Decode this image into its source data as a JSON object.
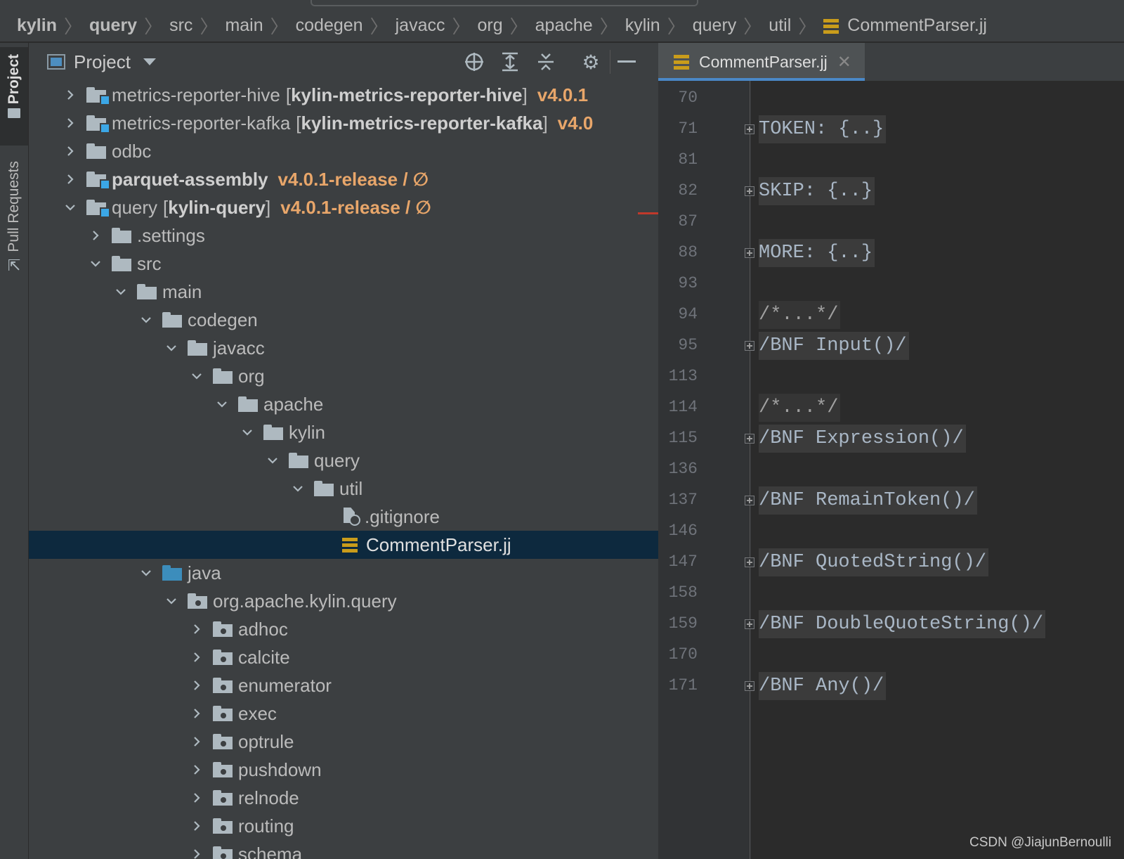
{
  "breadcrumb": [
    "kylin",
    "query",
    "src",
    "main",
    "codegen",
    "javacc",
    "org",
    "apache",
    "kylin",
    "query",
    "util",
    "CommentParser.jj"
  ],
  "sidebar": {
    "project_tab": "Project",
    "pull_requests_tab": "Pull Requests"
  },
  "project_panel": {
    "title": "Project"
  },
  "tree": [
    {
      "label": "metrics-reporter-hive",
      "module": "[kylin-metrics-reporter-hive]",
      "ver": "v4.0.1"
    },
    {
      "label": "metrics-reporter-kafka",
      "module": "[kylin-metrics-reporter-kafka]",
      "ver": "v4.0"
    },
    {
      "label": "odbc"
    },
    {
      "label": "parquet-assembly",
      "ver": "v4.0.1-release / ∅"
    },
    {
      "label": "query",
      "module": "[kylin-query]",
      "ver": "v4.0.1-release / ∅"
    },
    {
      "label": ".settings"
    },
    {
      "label": "src"
    },
    {
      "label": "main"
    },
    {
      "label": "codegen"
    },
    {
      "label": "javacc"
    },
    {
      "label": "org"
    },
    {
      "label": "apache"
    },
    {
      "label": "kylin"
    },
    {
      "label": "query"
    },
    {
      "label": "util"
    },
    {
      "label": ".gitignore"
    },
    {
      "label": "CommentParser.jj"
    },
    {
      "label": "java"
    },
    {
      "label": "org.apache.kylin.query"
    },
    {
      "label": "adhoc"
    },
    {
      "label": "calcite"
    },
    {
      "label": "enumerator"
    },
    {
      "label": "exec"
    },
    {
      "label": "optrule"
    },
    {
      "label": "pushdown"
    },
    {
      "label": "relnode"
    },
    {
      "label": "routing"
    },
    {
      "label": "schema"
    }
  ],
  "editor": {
    "tab_label": "CommentParser.jj",
    "lines": [
      "70",
      "71",
      "81",
      "82",
      "87",
      "88",
      "93",
      "94",
      "95",
      "113",
      "114",
      "115",
      "136",
      "137",
      "146",
      "147",
      "158",
      "159",
      "170",
      "171"
    ],
    "code": [
      "",
      "TOKEN: {..}",
      "",
      "SKIP: {..}",
      "",
      "MORE: {..}",
      "",
      "/*...*/",
      "/BNF Input()/",
      "",
      "/*...*/",
      "/BNF Expression()/",
      "",
      "/BNF RemainToken()/",
      "",
      "/BNF QuotedString()/",
      "",
      "/BNF DoubleQuoteString()/",
      "",
      "/BNF Any()/"
    ]
  },
  "watermark": "CSDN @JiajunBernoulli",
  "colors": {
    "panel": "#3c3f41",
    "editor": "#2b2b2b",
    "selection": "#0d293e",
    "version": "#e8a66a",
    "accent": "#4a88c7"
  }
}
